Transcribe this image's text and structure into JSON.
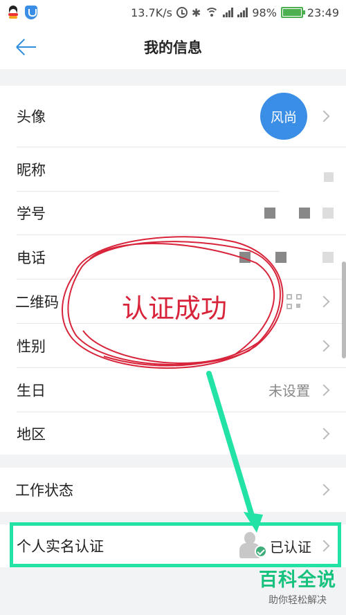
{
  "status_bar": {
    "speed": "13.7K/s",
    "battery": "98%",
    "time": "23:49",
    "icons": [
      "qq-icon",
      "shield-icon",
      "alarm-icon",
      "bluetooth-icon",
      "wifi-icon",
      "signal-icon",
      "battery-icon"
    ]
  },
  "header": {
    "title": "我的信息"
  },
  "profile": {
    "avatar": {
      "label": "头像",
      "text": "风尚"
    },
    "nickname": {
      "label": "昵称"
    },
    "student_id": {
      "label": "学号"
    },
    "phone": {
      "label": "电话"
    },
    "qr_code": {
      "label": "二维码"
    },
    "gender": {
      "label": "性别"
    },
    "birthday": {
      "label": "生日",
      "value": "未设置"
    },
    "region": {
      "label": "地区"
    }
  },
  "work": {
    "status": {
      "label": "工作状态"
    }
  },
  "verification": {
    "label": "个人实名认证",
    "value": "已认证"
  },
  "annotation": {
    "text": "认证成功",
    "colors": {
      "ink": "#d8243a",
      "arrow": "#22e3a5"
    }
  },
  "watermark": {
    "main": "百科全说",
    "sub": "助你轻松解决"
  },
  "colors": {
    "accent": "#2f8ee0",
    "avatar_bg": "#3a8ee6",
    "battery": "#4caf50",
    "verified_badge": "#3fae7a"
  }
}
